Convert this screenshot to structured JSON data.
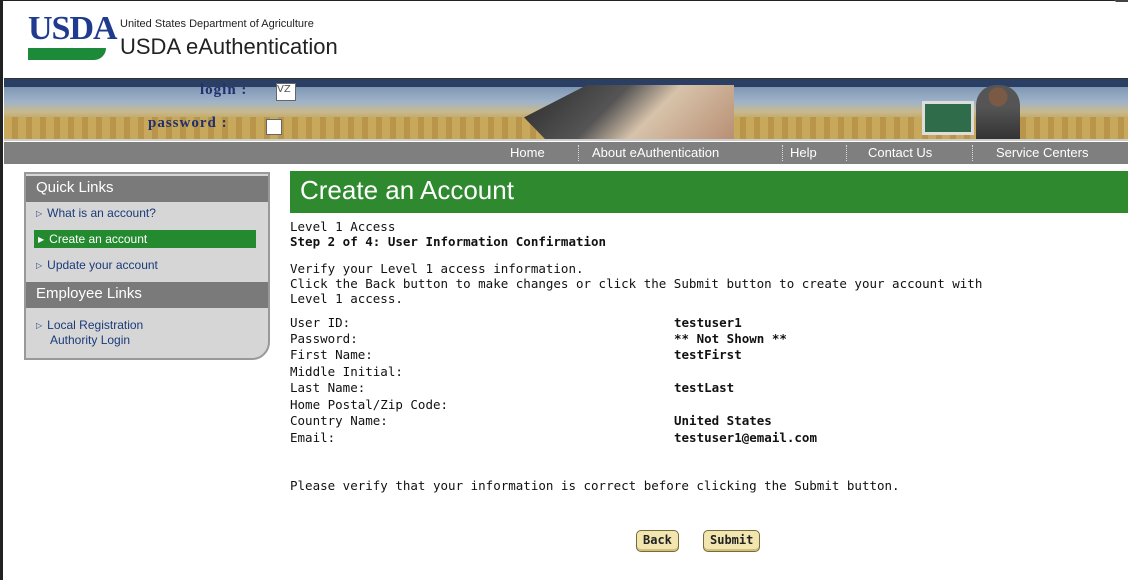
{
  "header": {
    "logo_text": "USDA",
    "department": "United States Department of Agriculture",
    "app_name": "USDA eAuthentication"
  },
  "banner": {
    "login_label": "login :",
    "login_value": "VZ",
    "password_label": "password :"
  },
  "nav": {
    "items": [
      "Home",
      "About eAuthentication",
      "Help",
      "Contact Us",
      "Service Centers"
    ]
  },
  "sidebar": {
    "quick_links_title": "Quick Links",
    "quick_links": [
      {
        "label": "What is an account?",
        "active": false
      },
      {
        "label": "Create an account",
        "active": true
      },
      {
        "label": "Update your account",
        "active": false
      }
    ],
    "employee_links_title": "Employee Links",
    "employee_links": [
      {
        "label_line1": "Local Registration",
        "label_line2": "Authority Login"
      }
    ]
  },
  "main": {
    "title": "Create an Account",
    "access_level": "Level 1 Access",
    "step": "Step 2 of 4: User Information Confirmation",
    "instructions": [
      "Verify your Level 1 access information.",
      "Click the Back button to make changes or click the Submit button to create your account with",
      "Level 1 access."
    ],
    "fields": [
      {
        "label": "User ID:",
        "value": "testuser1"
      },
      {
        "label": "Password:",
        "value": "** Not Shown **"
      },
      {
        "label": "First Name:",
        "value": "testFirst"
      },
      {
        "label": "Middle Initial:",
        "value": ""
      },
      {
        "label": "Last Name:",
        "value": "testLast"
      },
      {
        "label": "Home Postal/Zip Code:",
        "value": ""
      },
      {
        "label": "Country Name:",
        "value": "United States"
      },
      {
        "label": "Email:",
        "value": "testuser1@email.com"
      }
    ],
    "verify_note": "Please verify that your information is correct before clicking the Submit button.",
    "back_button": "Back",
    "submit_button": "Submit"
  }
}
